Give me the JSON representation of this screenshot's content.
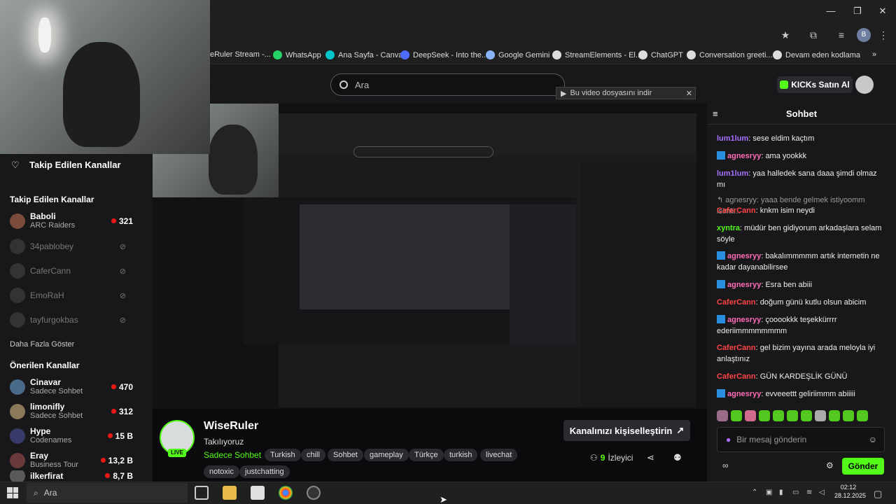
{
  "browser": {
    "bookmarks": [
      {
        "label": "eRuler Stream -...",
        "color": "#888"
      },
      {
        "label": "WhatsApp",
        "color": "#25d366"
      },
      {
        "label": "Ana Sayfa - Canva",
        "color": "#00c4cc"
      },
      {
        "label": "DeepSeek - Into the...",
        "color": "#4d6bfe"
      },
      {
        "label": "Google Gemini",
        "color": "#8ab4f8"
      },
      {
        "label": "StreamElements - El...",
        "color": "#ddd"
      },
      {
        "label": "ChatGPT",
        "color": "#ddd"
      },
      {
        "label": "Conversation greeti...",
        "color": "#ddd"
      },
      {
        "label": "Devam eden kodlama",
        "color": "#ddd"
      }
    ],
    "download_bar": "Bu video dosyasını indir"
  },
  "header": {
    "search_placeholder": "Ara",
    "kicks_button": "KICKs Satın Al"
  },
  "sidebar": {
    "followed_title": "Takip Edilen Kanallar",
    "followed_heading": "Takip Edilen Kanallar",
    "followed": [
      {
        "name": "Baboli",
        "sub": "ARC Raiders",
        "count": "321",
        "live": true
      },
      {
        "name": "34pablobey",
        "live": false
      },
      {
        "name": "CaferCann",
        "live": false
      },
      {
        "name": "EmoRaH",
        "live": false
      },
      {
        "name": "tayfurgokbas",
        "live": false
      }
    ],
    "more": "Daha Fazla Göster",
    "recommended_heading": "Önerilen Kanallar",
    "recommended": [
      {
        "name": "Cinavar",
        "sub": "Sadece Sohbet",
        "count": "470"
      },
      {
        "name": "limonifly",
        "sub": "Sadece Sohbet",
        "count": "312"
      },
      {
        "name": "Hype",
        "sub": "Codenames",
        "count": "15 B"
      },
      {
        "name": "Eray",
        "sub": "Business Tour",
        "count": "13,2 B"
      },
      {
        "name": "ilkerfirat",
        "sub": "",
        "count": "8,7 B"
      }
    ]
  },
  "stream": {
    "streamer": "WiseRuler",
    "title": "Takılıyoruz",
    "category": "Sadece Sohbet",
    "live": "LIVE",
    "tags": [
      "Turkish",
      "chill",
      "Sohbet",
      "gameplay",
      "Türkçe",
      "turkish",
      "livechat",
      "notoxic",
      "justchatting"
    ],
    "customize_button": "Kanalınızı kişiselleştirin",
    "viewers": "9",
    "viewers_label": "İzleyici"
  },
  "chat": {
    "title": "Sohbet",
    "messages": [
      {
        "user": "lum1lum",
        "color": "#a970ff",
        "text": "sese eldim kaçtım",
        "badge": false
      },
      {
        "user": "agnesryy",
        "color": "#ff6bb5",
        "text": "ama yookkk",
        "badge": true
      },
      {
        "user": "lum1lum",
        "color": "#a970ff",
        "text": "yaa halledek sana daaa şimdi olmaz mı",
        "badge": false
      },
      {
        "user": "",
        "color": "#999",
        "text": "↰ agnesryy: yaaa bende gelmek istiyoomm isimli...",
        "badge": false
      },
      {
        "user": "CaferCann",
        "color": "#ff4444",
        "text": "knkm isim neydi",
        "badge": false
      },
      {
        "user": "xyntra",
        "color": "#53fc18",
        "text": "müdür ben gidiyorum arkadaşlara selam söyle",
        "badge": false
      },
      {
        "user": "agnesryy",
        "color": "#ff6bb5",
        "text": "bakalımmmmm artık internetin ne kadar dayanabilirsee",
        "badge": true
      },
      {
        "user": "agnesryy",
        "color": "#ff6bb5",
        "text": "Esra ben abiii",
        "badge": true
      },
      {
        "user": "CaferCann",
        "color": "#ff4444",
        "text": "doğum günü kutlu olsun abicim",
        "badge": false
      },
      {
        "user": "agnesryy",
        "color": "#ff6bb5",
        "text": "çooookkk teşekkürrrr ederiimmmmmmmm",
        "badge": true
      },
      {
        "user": "CaferCann",
        "color": "#ff4444",
        "text": "gel bizim yayına arada meloyla iyi anlaştınız",
        "badge": false
      },
      {
        "user": "CaferCann",
        "color": "#ff4444",
        "text": "GÜN KARDEŞLİK GÜNÜ",
        "badge": false
      },
      {
        "user": "agnesryy",
        "color": "#ff6bb5",
        "text": "evveeettt geliriimmm abiiiii",
        "badge": true
      }
    ],
    "input_placeholder": "Bir mesaj gönderin",
    "send_button": "Gönder"
  },
  "taskbar": {
    "search_placeholder": "Ara",
    "time": "02:12",
    "date": "28.12.2025"
  }
}
